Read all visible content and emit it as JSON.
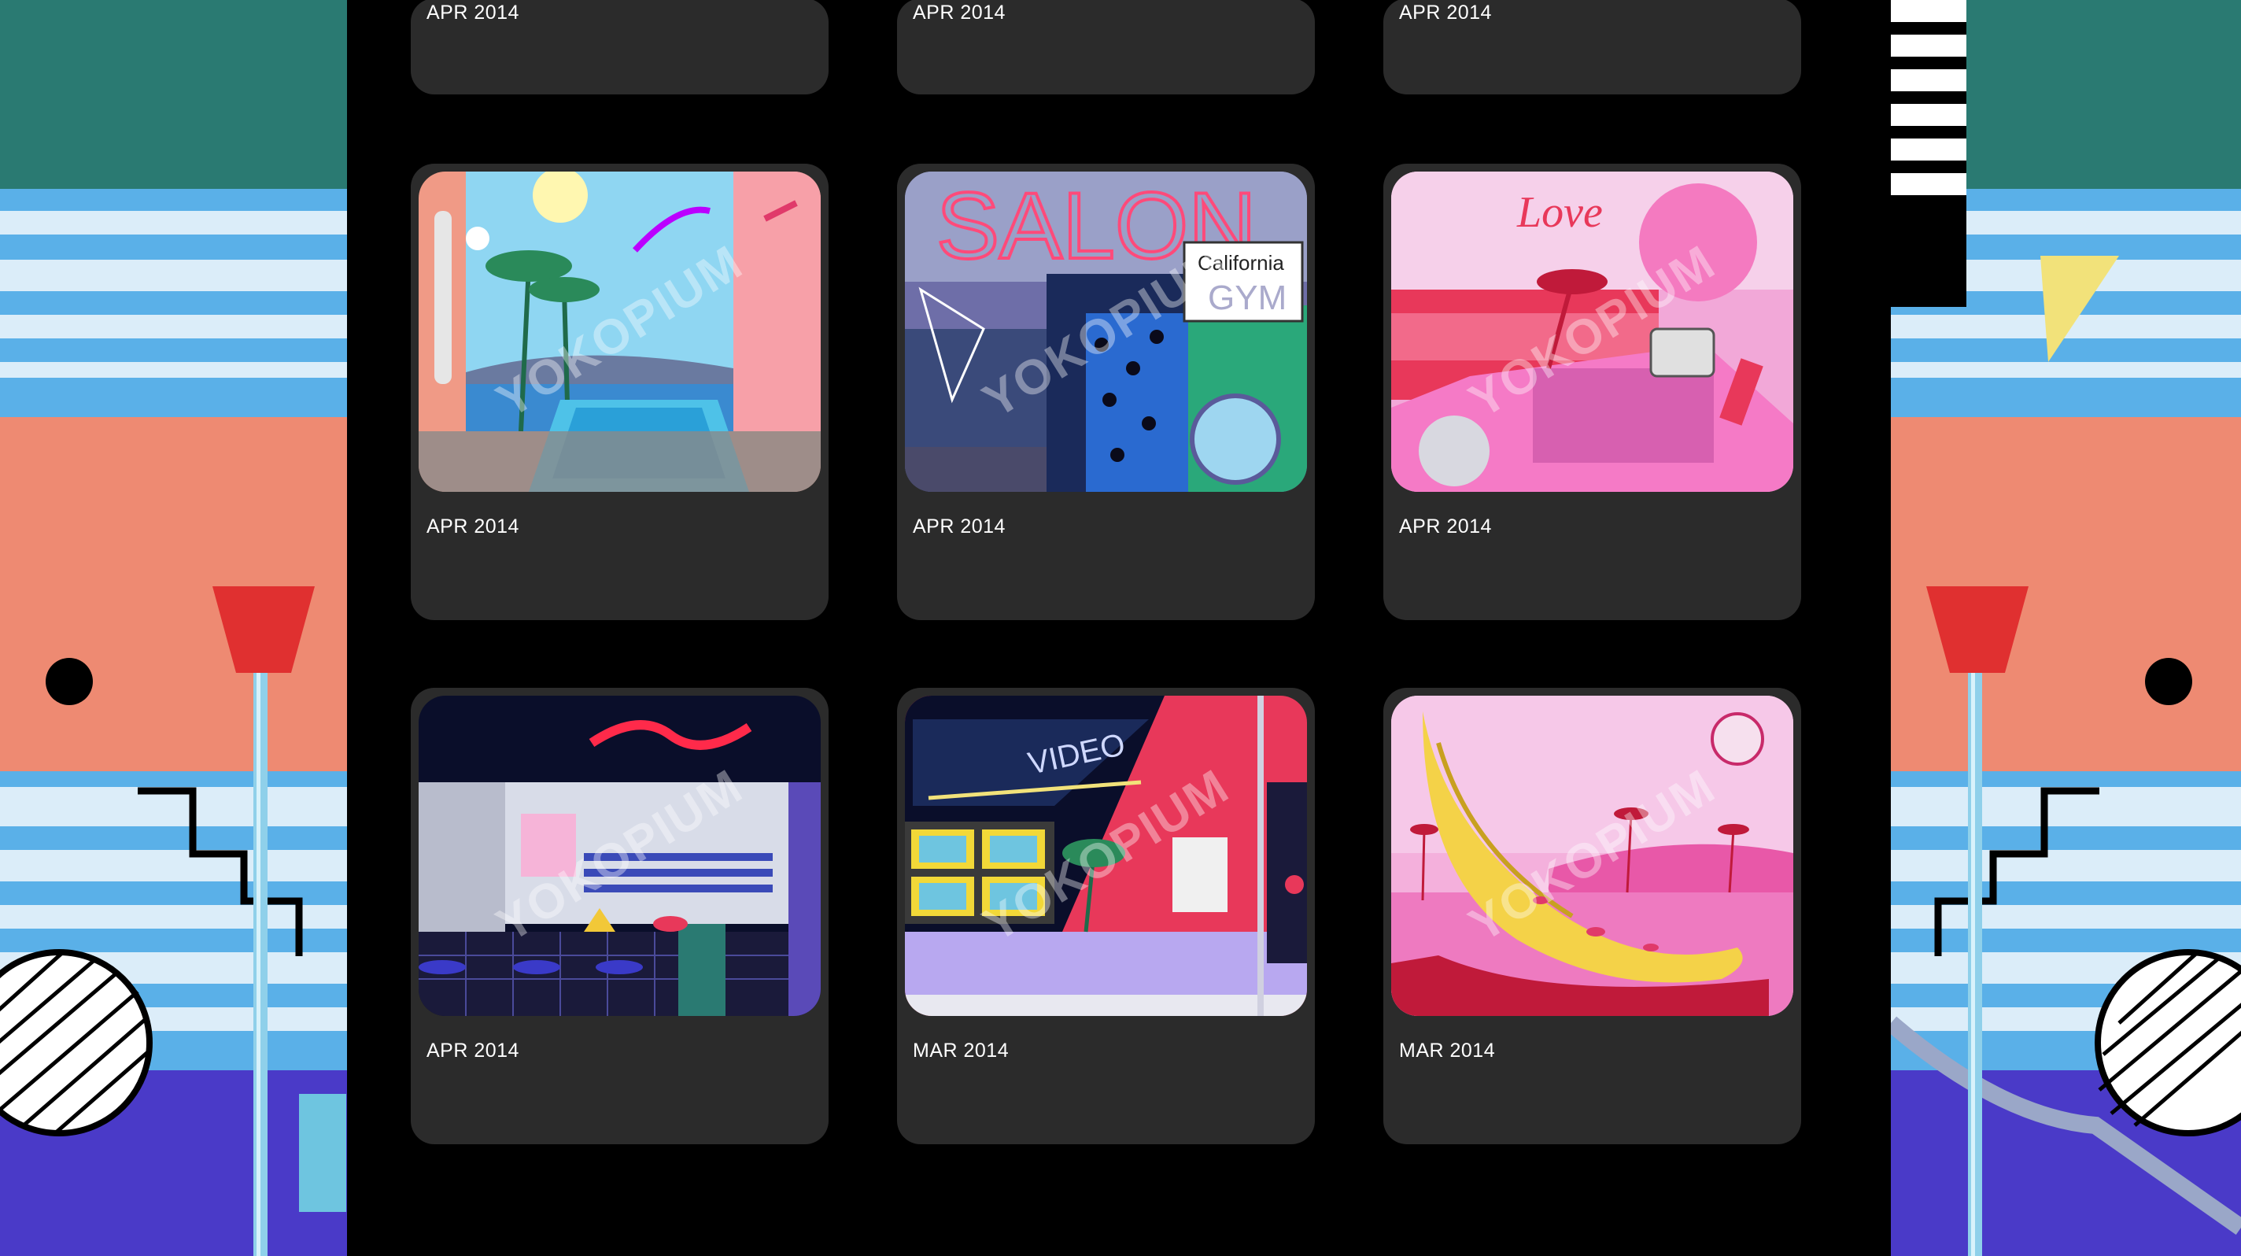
{
  "gallery": {
    "watermark": "YOKOPIUM",
    "top_row": [
      {
        "date": "APR 2014"
      },
      {
        "date": "APR 2014"
      },
      {
        "date": "APR 2014"
      }
    ],
    "items": [
      {
        "date": "APR 2014",
        "art": "bathroom-with-pool-artwork"
      },
      {
        "date": "APR 2014",
        "art": "salon-california-gym-artwork",
        "sign": "California",
        "sign2": "GYM",
        "neon": "SALON"
      },
      {
        "date": "APR 2014",
        "art": "love-pink-room-artwork",
        "neon": "Love"
      },
      {
        "date": "APR 2014",
        "art": "neon-kitchen-artwork"
      },
      {
        "date": "MAR 2014",
        "art": "video-store-artwork",
        "neon": "VIDEO"
      },
      {
        "date": "MAR 2014",
        "art": "banana-palm-artwork"
      }
    ]
  },
  "colors": {
    "card_bg": "#2b2b2b",
    "page_bg": "#000000",
    "accent_pink": "#e83a8a",
    "teal": "#2a7a72",
    "salmon": "#ee8a72",
    "violet": "#4a3ac8"
  }
}
